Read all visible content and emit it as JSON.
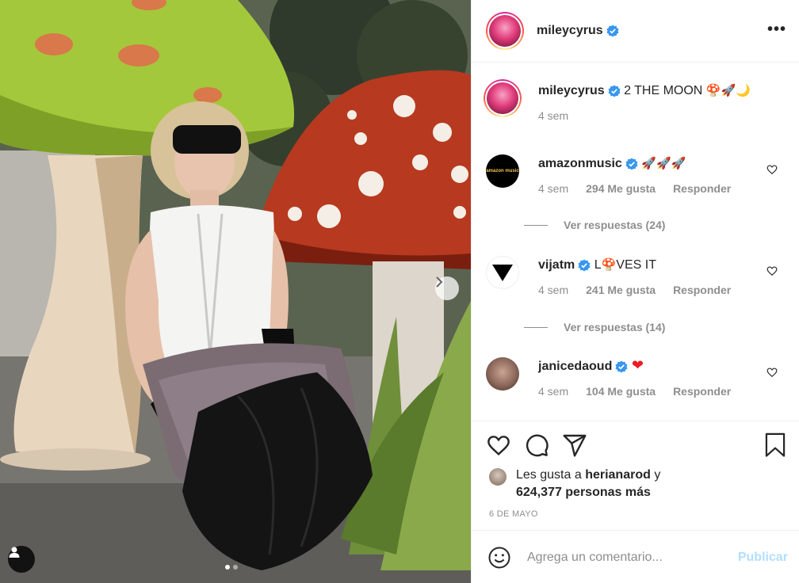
{
  "post": {
    "author": "mileycyrus",
    "caption_text": "2 THE MOON",
    "caption_emojis": "🍄🚀🌙",
    "caption_time": "4 sem",
    "date": "6 DE MAYO"
  },
  "comments": [
    {
      "username": "amazonmusic",
      "text": "🚀🚀🚀",
      "time": "4 sem",
      "likes": "294 Me gusta",
      "reply": "Responder",
      "view_replies": "Ver respuestas (24)",
      "avatar_text": "amazon music"
    },
    {
      "username": "vijatm",
      "text_before": "L",
      "text_emoji": "🍄",
      "text_after": "VES IT",
      "time": "4 sem",
      "likes": "241 Me gusta",
      "reply": "Responder",
      "view_replies": "Ver respuestas (14)"
    },
    {
      "username": "janicedaoud",
      "text": "❤",
      "time": "4 sem",
      "likes": "104 Me gusta",
      "reply": "Responder"
    }
  ],
  "likes_summary": {
    "prefix": "Les gusta a",
    "user": "herianarod",
    "joiner": "y",
    "count": "624,377 personas más"
  },
  "add_comment": {
    "placeholder": "Agrega un comentario...",
    "publish": "Publicar"
  },
  "colors": {
    "verified": "#3897f0",
    "heart_red": "#ed1c24",
    "publish_disabled": "#b2dffc",
    "secondary_text": "#8e8e8e"
  },
  "carousel": {
    "total": 2,
    "current": 1
  }
}
